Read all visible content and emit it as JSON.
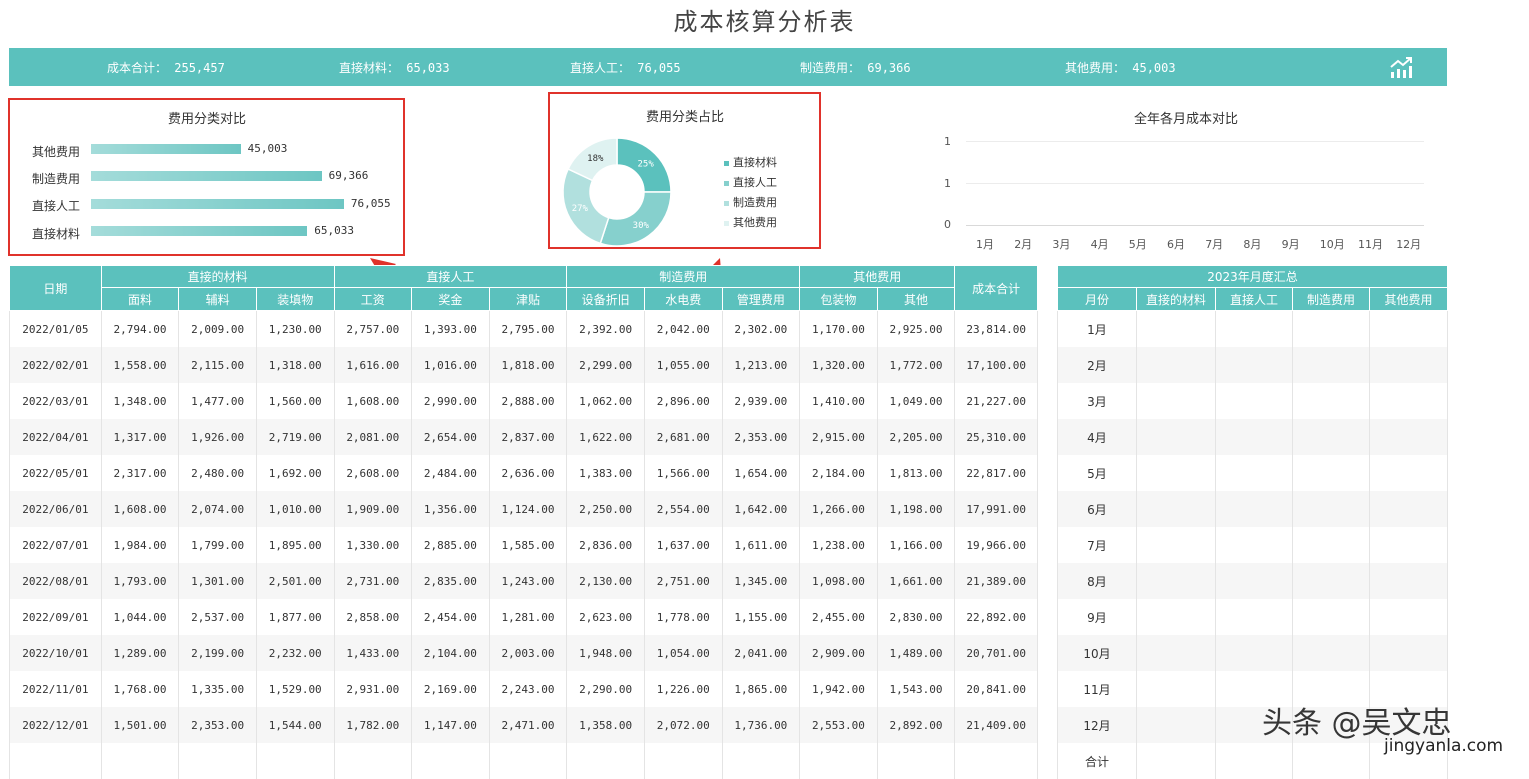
{
  "title": "成本核算分析表",
  "summary": {
    "items": [
      {
        "label": "成本合计：",
        "value": "255,457"
      },
      {
        "label": "直接材料：",
        "value": "65,033"
      },
      {
        "label": "直接人工：",
        "value": "76,055"
      },
      {
        "label": "制造费用：",
        "value": "69,366"
      },
      {
        "label": "其他费用：",
        "value": "45,003"
      }
    ],
    "icon": "trend-chart-icon"
  },
  "colors": {
    "accent": "#5bc1bd",
    "highlight": "#e0322b"
  },
  "bar_panel": {
    "title": "费用分类对比",
    "labels": [
      "其他费用",
      "制造费用",
      "直接人工",
      "直接材料"
    ],
    "value_labels": [
      "45,003",
      "69,366",
      "76,055",
      "65,033"
    ]
  },
  "donut_panel": {
    "title": "费用分类占比",
    "slice_labels": [
      "25%",
      "30%",
      "27%",
      "18%"
    ],
    "legend": [
      "直接材料",
      "直接人工",
      "制造费用",
      "其他费用"
    ]
  },
  "line_panel": {
    "title": "全年各月成本对比",
    "y_ticks": [
      "1",
      "1",
      "0"
    ],
    "x_ticks": [
      "1月",
      "2月",
      "3月",
      "4月",
      "5月",
      "6月",
      "7月",
      "8月",
      "9月",
      "10月",
      "11月",
      "12月"
    ]
  },
  "chart_data": [
    {
      "type": "bar",
      "title": "费用分类对比",
      "categories": [
        "其他费用",
        "制造费用",
        "直接人工",
        "直接材料"
      ],
      "values": [
        45003,
        69366,
        76055,
        65033
      ]
    },
    {
      "type": "pie",
      "title": "费用分类占比",
      "categories": [
        "直接材料",
        "直接人工",
        "制造费用",
        "其他费用"
      ],
      "values": [
        25,
        30,
        27,
        18
      ],
      "colors": [
        "#5bc1bd",
        "#86d0cd",
        "#b1e0de",
        "#dff2f1"
      ]
    },
    {
      "type": "line",
      "title": "全年各月成本对比",
      "categories": [
        "1月",
        "2月",
        "3月",
        "4月",
        "5月",
        "6月",
        "7月",
        "8月",
        "9月",
        "10月",
        "11月",
        "12月"
      ],
      "series": [],
      "grid": true
    }
  ],
  "main_table": {
    "groups": {
      "date": "日期",
      "material": "直接的材料",
      "labor": "直接人工",
      "manufacturing": "制造费用",
      "other": "其他费用",
      "total": "成本合计"
    },
    "subheaders": [
      "面料",
      "辅料",
      "装填物",
      "工资",
      "奖金",
      "津贴",
      "设备折旧",
      "水电费",
      "管理费用",
      "包装物",
      "其他"
    ],
    "rows": [
      [
        "2022/01/05",
        "2,794.00",
        "2,009.00",
        "1,230.00",
        "2,757.00",
        "1,393.00",
        "2,795.00",
        "2,392.00",
        "2,042.00",
        "2,302.00",
        "1,170.00",
        "2,925.00",
        "23,814.00"
      ],
      [
        "2022/02/01",
        "1,558.00",
        "2,115.00",
        "1,318.00",
        "1,616.00",
        "1,016.00",
        "1,818.00",
        "2,299.00",
        "1,055.00",
        "1,213.00",
        "1,320.00",
        "1,772.00",
        "17,100.00"
      ],
      [
        "2022/03/01",
        "1,348.00",
        "1,477.00",
        "1,560.00",
        "1,608.00",
        "2,990.00",
        "2,888.00",
        "1,062.00",
        "2,896.00",
        "2,939.00",
        "1,410.00",
        "1,049.00",
        "21,227.00"
      ],
      [
        "2022/04/01",
        "1,317.00",
        "1,926.00",
        "2,719.00",
        "2,081.00",
        "2,654.00",
        "2,837.00",
        "1,622.00",
        "2,681.00",
        "2,353.00",
        "2,915.00",
        "2,205.00",
        "25,310.00"
      ],
      [
        "2022/05/01",
        "2,317.00",
        "2,480.00",
        "1,692.00",
        "2,608.00",
        "2,484.00",
        "2,636.00",
        "1,383.00",
        "1,566.00",
        "1,654.00",
        "2,184.00",
        "1,813.00",
        "22,817.00"
      ],
      [
        "2022/06/01",
        "1,608.00",
        "2,074.00",
        "1,010.00",
        "1,909.00",
        "1,356.00",
        "1,124.00",
        "2,250.00",
        "2,554.00",
        "1,642.00",
        "1,266.00",
        "1,198.00",
        "17,991.00"
      ],
      [
        "2022/07/01",
        "1,984.00",
        "1,799.00",
        "1,895.00",
        "1,330.00",
        "2,885.00",
        "1,585.00",
        "2,836.00",
        "1,637.00",
        "1,611.00",
        "1,238.00",
        "1,166.00",
        "19,966.00"
      ],
      [
        "2022/08/01",
        "1,793.00",
        "1,301.00",
        "2,501.00",
        "2,731.00",
        "2,835.00",
        "1,243.00",
        "2,130.00",
        "2,751.00",
        "1,345.00",
        "1,098.00",
        "1,661.00",
        "21,389.00"
      ],
      [
        "2022/09/01",
        "1,044.00",
        "2,537.00",
        "1,877.00",
        "2,858.00",
        "2,454.00",
        "1,281.00",
        "2,623.00",
        "1,778.00",
        "1,155.00",
        "2,455.00",
        "2,830.00",
        "22,892.00"
      ],
      [
        "2022/10/01",
        "1,289.00",
        "2,199.00",
        "2,232.00",
        "1,433.00",
        "2,104.00",
        "2,003.00",
        "1,948.00",
        "1,054.00",
        "2,041.00",
        "2,909.00",
        "1,489.00",
        "20,701.00"
      ],
      [
        "2022/11/01",
        "1,768.00",
        "1,335.00",
        "1,529.00",
        "2,931.00",
        "2,169.00",
        "2,243.00",
        "2,290.00",
        "1,226.00",
        "1,865.00",
        "1,942.00",
        "1,543.00",
        "20,841.00"
      ],
      [
        "2022/12/01",
        "1,501.00",
        "2,353.00",
        "1,544.00",
        "1,782.00",
        "1,147.00",
        "2,471.00",
        "1,358.00",
        "2,072.00",
        "1,736.00",
        "2,553.00",
        "2,892.00",
        "21,409.00"
      ],
      [
        "",
        "",
        "",
        "",
        "",
        "",
        "",
        "",
        "",
        "",
        "",
        "",
        ""
      ]
    ]
  },
  "summary_table": {
    "title": "2023年月度汇总",
    "headers": [
      "月份",
      "直接的材料",
      "直接人工",
      "制造费用",
      "其他费用"
    ],
    "months": [
      "1月",
      "2月",
      "3月",
      "4月",
      "5月",
      "6月",
      "7月",
      "8月",
      "9月",
      "10月",
      "11月",
      "12月",
      "合计"
    ]
  },
  "watermark": {
    "line1": "头条 @吴文忠",
    "line2": "jingyanla.com"
  }
}
